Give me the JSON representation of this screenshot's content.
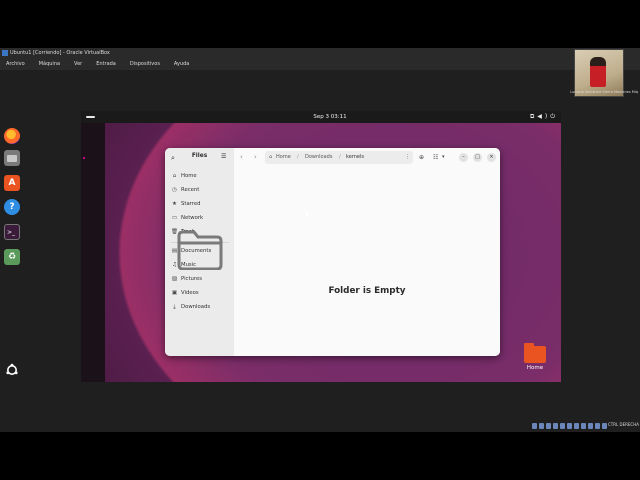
{
  "host": {
    "title": "Ubuntu1 [Corriendo] - Oracle VirtualBox",
    "menu": [
      "Archivo",
      "Máquina",
      "Ver",
      "Entrada",
      "Dispositivos",
      "Ayuda"
    ],
    "webcam_label": "Luciano Salvatore Sierra Maulenes Miq",
    "host_key": "CTRL DERECHA"
  },
  "guest": {
    "clock": "Sep 3  03:11",
    "desktop_icon_label": "Home"
  },
  "files": {
    "sidebar_title": "Files",
    "sidebar_items": [
      {
        "icon": "home-icon",
        "glyph": "⌂",
        "label": "Home"
      },
      {
        "icon": "recent-icon",
        "glyph": "◷",
        "label": "Recent"
      },
      {
        "icon": "starred-icon",
        "glyph": "★",
        "label": "Starred"
      },
      {
        "icon": "network-icon",
        "glyph": "▭",
        "label": "Network"
      },
      {
        "icon": "trash-icon",
        "glyph": "🗑",
        "label": "Trash"
      },
      {
        "icon": "documents-icon",
        "glyph": "▤",
        "label": "Documents"
      },
      {
        "icon": "music-icon",
        "glyph": "♫",
        "label": "Music"
      },
      {
        "icon": "pictures-icon",
        "glyph": "▨",
        "label": "Pictures"
      },
      {
        "icon": "videos-icon",
        "glyph": "▣",
        "label": "Videos"
      },
      {
        "icon": "downloads-icon",
        "glyph": "⤓",
        "label": "Downloads"
      }
    ],
    "path": [
      "Home",
      "Downloads",
      "kernels"
    ],
    "empty_message": "Folder is Empty"
  }
}
